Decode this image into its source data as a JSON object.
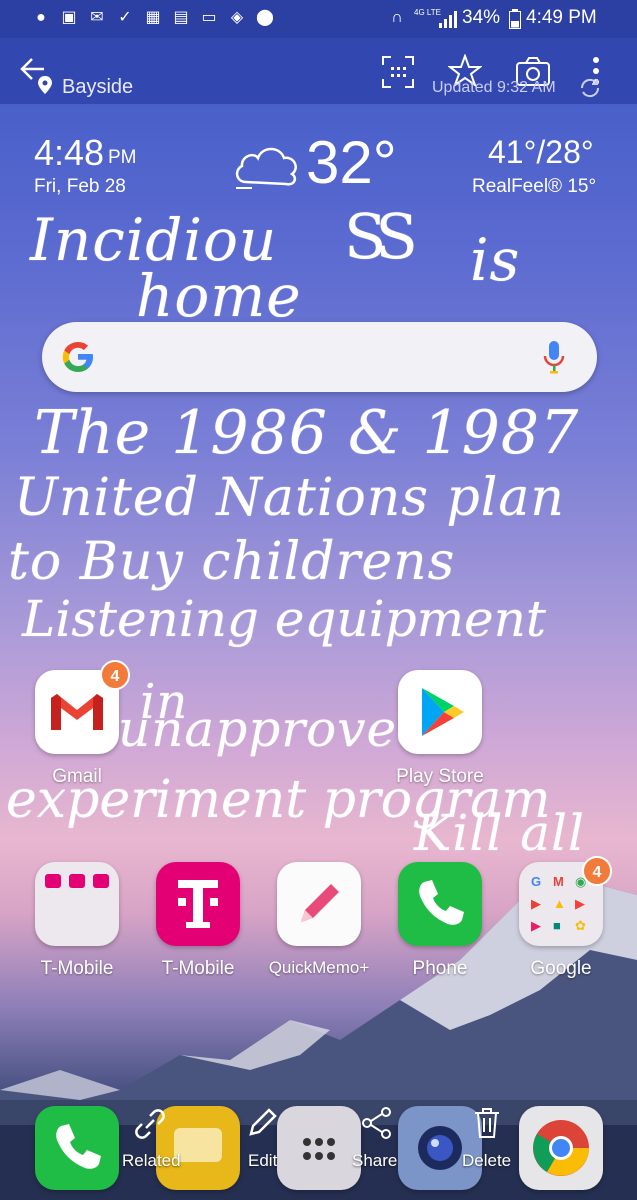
{
  "status_bar": {
    "battery": "34%",
    "time": "4:49 PM",
    "network": "4G LTE"
  },
  "app_bar": {
    "location": "Bayside",
    "updated": "Updated 9:32 AM"
  },
  "weather": {
    "time": "4:48",
    "ampm": "PM",
    "date": "Fri, Feb 28",
    "temp": "32°",
    "high_low": "41°/28°",
    "realfeel": "RealFeel® 15°"
  },
  "handwriting": {
    "line1": "Incidiou",
    "mark": "SS",
    "line1b": "is",
    "line2": "home",
    "line3": "The 1986 & 1987",
    "line4": "United Nations plan",
    "line5": "to Buy childrens",
    "line6": "Listening equipment",
    "line7": "in",
    "line8": "unapproved",
    "line9": "experiment program",
    "line10": "Kill all"
  },
  "apps_row1": [
    {
      "label": "Gmail",
      "badge": "4"
    },
    {
      "label": "Play Store"
    }
  ],
  "apps_row2": [
    {
      "label": "T-Mobile"
    },
    {
      "label": "T-Mobile"
    },
    {
      "label": "QuickMemo+"
    },
    {
      "label": "Phone"
    },
    {
      "label": "Google",
      "badge": "4"
    }
  ],
  "dock_actions": {
    "related": "Related",
    "edit": "Edit",
    "share": "Share",
    "delete": "Delete"
  },
  "colors": {
    "status_bar": "#2c3fa3",
    "app_bar": "#3347b0",
    "badge": "#f27a3a",
    "tmobile": "#e20074",
    "phone": "#1fbd45"
  }
}
